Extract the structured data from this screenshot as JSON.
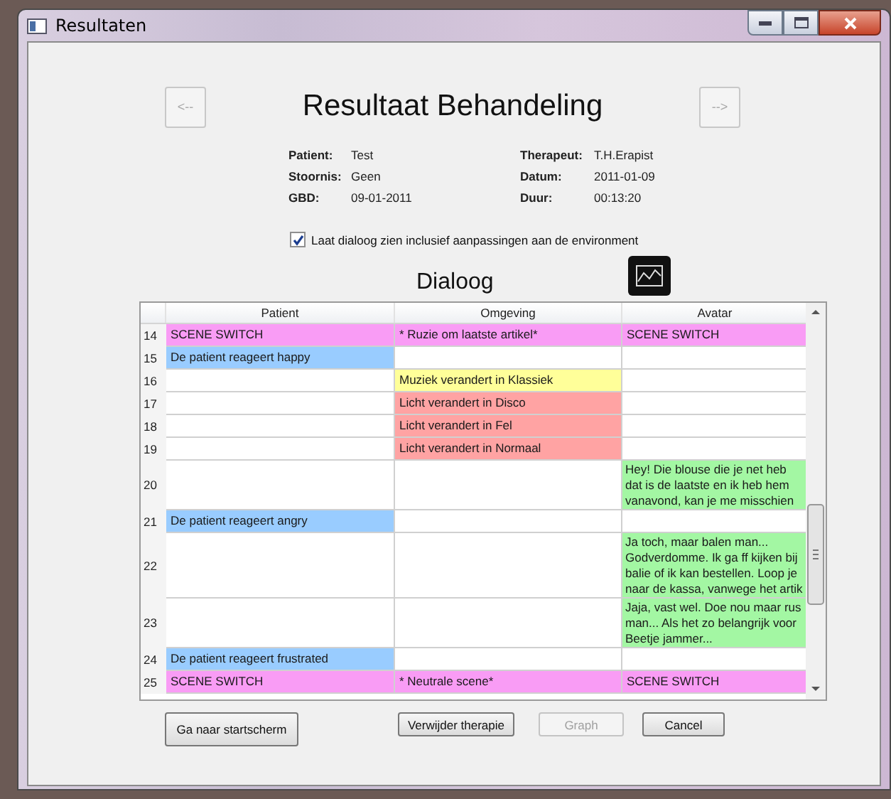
{
  "window": {
    "title": "Resultaten"
  },
  "nav": {
    "previous": "<--",
    "next": "-->"
  },
  "title": "Resultaat Behandeling",
  "info": [
    {
      "label": "Patient:",
      "value": "Test"
    },
    {
      "label": "Therapeut:",
      "value": "T.H.Erapist"
    },
    {
      "label": "Stoornis:",
      "value": "Geen"
    },
    {
      "label": "Datum:",
      "value": "2011-01-09"
    },
    {
      "label": "GBD:",
      "value": "09-01-2011"
    },
    {
      "label": "Duur:",
      "value": "00:13:20"
    }
  ],
  "option": {
    "label": "Laat dialoog zien inclusief aanpassingen aan de environment",
    "checked": true
  },
  "dialog": {
    "title": "Dialoog",
    "columns": [
      "Patient",
      "Omgeving",
      "Avatar"
    ],
    "rows": [
      {
        "number": "14",
        "patient": {
          "text": "SCENE SWITCH",
          "color": "#f99cf5"
        },
        "omgeving": {
          "text": "* Ruzie om laatste artikel*",
          "color": "#f99cf5"
        },
        "avatar": {
          "text": "SCENE SWITCH",
          "color": "#f99cf5"
        }
      },
      {
        "number": "15",
        "patient": {
          "text": "De patient reageert happy",
          "color": "#99ccff"
        }
      },
      {
        "number": "16",
        "omgeving": {
          "text": "Muziek verandert in Klassiek",
          "color": "#ffff99"
        }
      },
      {
        "number": "17",
        "omgeving": {
          "text": "Licht verandert in Disco",
          "color": "#ffa3a3"
        }
      },
      {
        "number": "18",
        "omgeving": {
          "text": "Licht verandert in Fel",
          "color": "#ffa3a3"
        }
      },
      {
        "number": "19",
        "omgeving": {
          "text": "Licht verandert in Normaal",
          "color": "#ffa3a3"
        }
      },
      {
        "number": "20",
        "avatar": {
          "lines": [
            "Hey! Die blouse die je net heb",
            "dat is de laatste en ik heb hem",
            "vanavond, kan je me misschien"
          ],
          "color": "#a3f7a3"
        }
      },
      {
        "number": "21",
        "patient": {
          "text": "De patient reageert angry",
          "color": "#99ccff"
        }
      },
      {
        "number": "22",
        "avatar": {
          "lines": [
            "Ja toch, maar balen man...",
            "Godverdomme. Ik ga ff kijken bij",
            "balie of ik kan bestellen. Loop je",
            "naar de kassa, vanwege het artik"
          ],
          "color": "#a3f7a3"
        }
      },
      {
        "number": "23",
        "avatar": {
          "lines": [
            "Jaja, vast wel. Doe nou maar rus",
            "man... Als het zo belangrijk voor",
            "Beetje jammer..."
          ],
          "color": "#a3f7a3"
        }
      },
      {
        "number": "24",
        "patient": {
          "text": "De patient reageert frustrated",
          "color": "#99ccff"
        }
      },
      {
        "number": "25",
        "patient": {
          "text": "SCENE SWITCH",
          "color": "#f99cf5"
        },
        "omgeving": {
          "text": "* Neutrale scene*",
          "color": "#f99cf5"
        },
        "avatar": {
          "text": "SCENE SWITCH",
          "color": "#f99cf5"
        }
      }
    ]
  },
  "buttons": [
    {
      "label": "Ga naar startscherm",
      "disabled": false
    },
    {
      "label": "Verwijder therapie",
      "disabled": false
    },
    {
      "label": "Graph",
      "disabled": true
    },
    {
      "label": "Cancel",
      "disabled": false
    }
  ]
}
